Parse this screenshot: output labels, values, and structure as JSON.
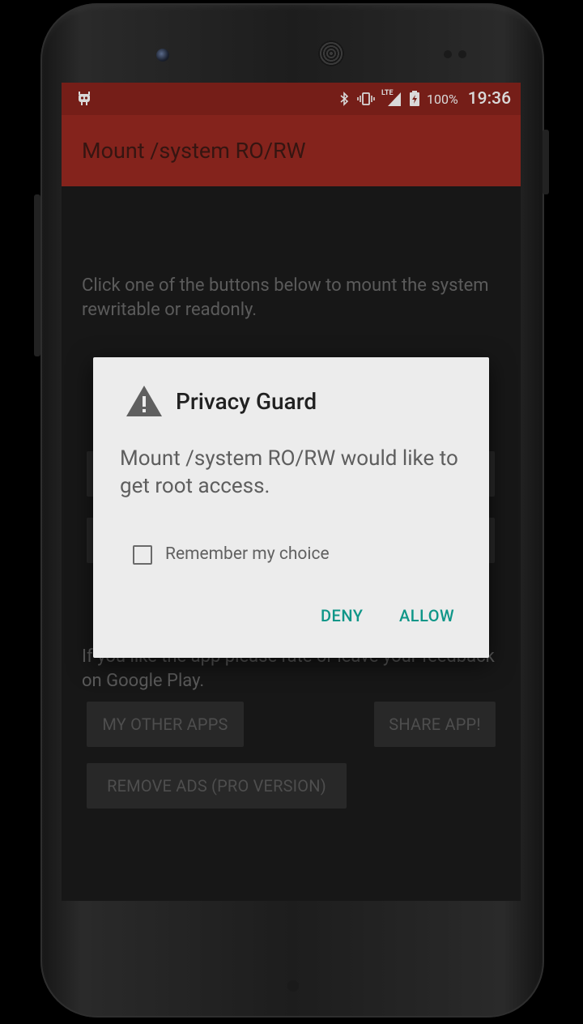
{
  "status_bar": {
    "battery_percent": "100%",
    "time": "19:36",
    "network_label": "LTE",
    "icons": [
      "cyanogenmod-icon",
      "bluetooth-icon",
      "vibrate-icon",
      "lte-signal-icon",
      "battery-charging-icon"
    ]
  },
  "app_bar": {
    "title": "Mount /system RO/RW"
  },
  "content": {
    "intro_text": "Click one of the buttons below to mount the system rewritable or readonly.",
    "rate_text": "If you like the app please rate or leave your feedback on Google Play.",
    "buttons": {
      "my_other_apps": "MY OTHER APPS",
      "share_app": "SHARE APP!",
      "remove_ads": "REMOVE ADS (PRO VERSION)"
    }
  },
  "dialog": {
    "title": "Privacy Guard",
    "message": "Mount /system RO/RW would like to get root access.",
    "checkbox_label": "Remember my choice",
    "checkbox_checked": false,
    "deny_label": "DENY",
    "allow_label": "ALLOW"
  },
  "colors": {
    "status_bar": "#8a241d",
    "app_bar": "#9c2a21",
    "accent": "#0f9688",
    "dialog_bg": "#ececec"
  }
}
